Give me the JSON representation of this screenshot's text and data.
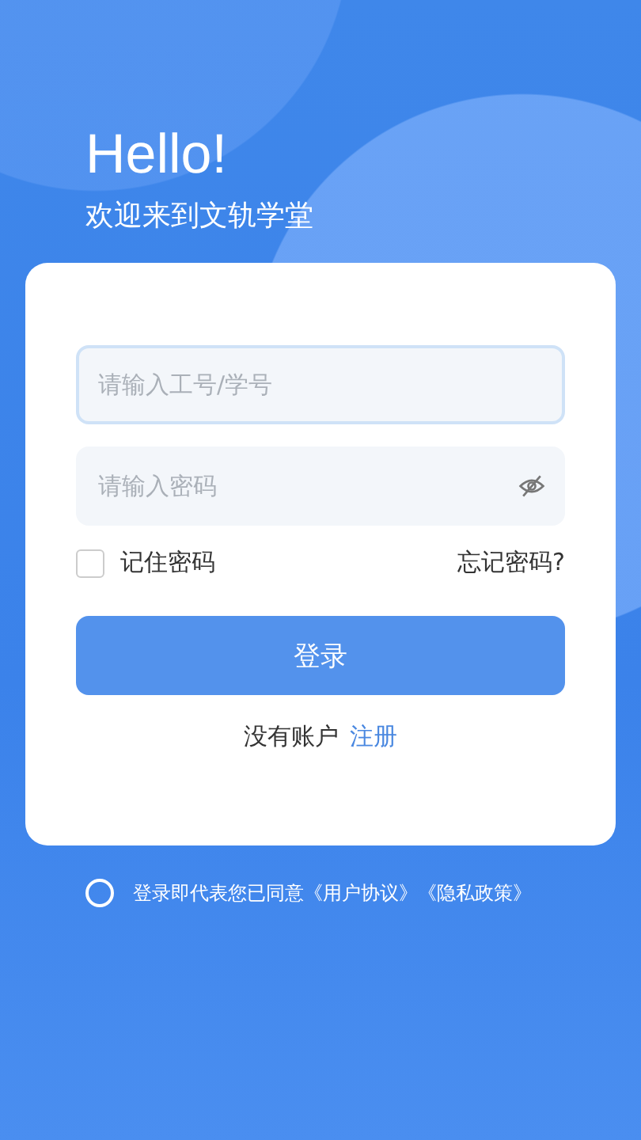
{
  "header": {
    "greeting": "Hello!",
    "subtitle": "欢迎来到文轨学堂"
  },
  "form": {
    "account": {
      "placeholder": "请输入工号/学号",
      "focused": true
    },
    "password": {
      "placeholder": "请输入密码",
      "focused": false
    },
    "remember": {
      "label": "记住密码",
      "checked": false
    },
    "forgot": "忘记密码?",
    "login_button": "登录",
    "register": {
      "prompt": "没有账户",
      "link": "注册"
    }
  },
  "agreement": {
    "checked": false,
    "text": "登录即代表您已同意",
    "links": [
      "《用户协议》",
      "《隐私政策》"
    ]
  }
}
